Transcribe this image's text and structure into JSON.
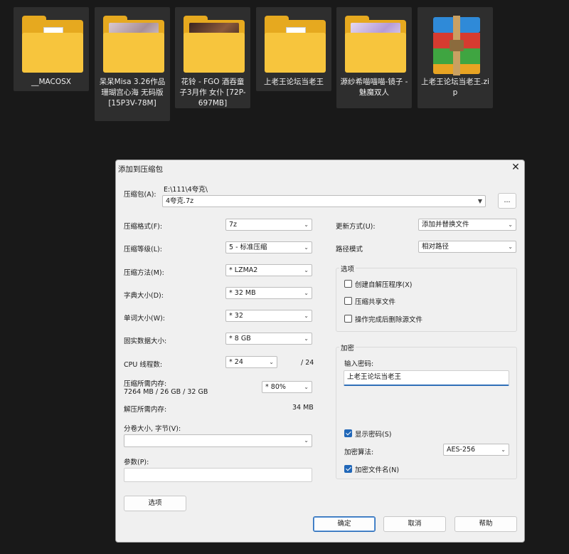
{
  "desktop": {
    "files": [
      {
        "name": "__MACOSX",
        "type": "folder-doc-icon"
      },
      {
        "name": "呆呆Misa 3.26作品 珊瑚宫心海 无码版 [15P3V-78M]",
        "type": "folder-photo-icon"
      },
      {
        "name": "花铃 - FGO 酒吞童子3月作 女仆 [72P-697MB]",
        "type": "folder-photo-icon"
      },
      {
        "name": "上老王论坛当老王",
        "type": "folder-doc-icon"
      },
      {
        "name": "源纱希喵喵喵-镜子 - 魅魔双人",
        "type": "folder-photo-icon"
      },
      {
        "name": "上老王论坛当老王.zip",
        "type": "archive-icon"
      }
    ]
  },
  "dialog": {
    "title": "添加到压缩包",
    "archive_label": "压缩包(A):",
    "archive_path": "E:\\111\\4夸克\\",
    "archive_name": "4夸克.7z",
    "browse_label": "...",
    "left": {
      "format_label": "压缩格式(F):",
      "format_value": "7z",
      "level_label": "压缩等级(L):",
      "level_value": "5 - 标准压缩",
      "method_label": "压缩方法(M):",
      "method_value": "*  LZMA2",
      "dict_label": "字典大小(D):",
      "dict_value": "*  32 MB",
      "word_label": "单词大小(W):",
      "word_value": "*  32",
      "solid_label": "固实数据大小:",
      "solid_value": "*  8 GB",
      "threads_label": "CPU 线程数:",
      "threads_value": "*  24",
      "threads_max": "/ 24",
      "mem_label": "压缩所需内存:",
      "mem_detail": "7264 MB / 26 GB / 32 GB",
      "mem_value": "*  80%",
      "decomp_label": "解压所需内存:",
      "decomp_value": "34 MB",
      "split_label": "分卷大小, 字节(V):",
      "split_value": "",
      "params_label": "参数(P):",
      "params_value": "",
      "options_button": "选项"
    },
    "right": {
      "update_label": "更新方式(U):",
      "update_value": "添加并替换文件",
      "path_label": "路径模式",
      "path_value": "相对路径",
      "options_group": "选项",
      "opt_sfx": "创建自解压程序(X)",
      "opt_shared": "压缩共享文件",
      "opt_delete": "操作完成后删除源文件",
      "encrypt_group": "加密",
      "password_label": "输入密码:",
      "password_value": "上老王论坛当老王",
      "show_password": "显示密码(S)",
      "method_label": "加密算法:",
      "method_value": "AES-256",
      "encrypt_names": "加密文件名(N)"
    },
    "buttons": {
      "ok": "确定",
      "cancel": "取消",
      "help": "帮助"
    }
  }
}
